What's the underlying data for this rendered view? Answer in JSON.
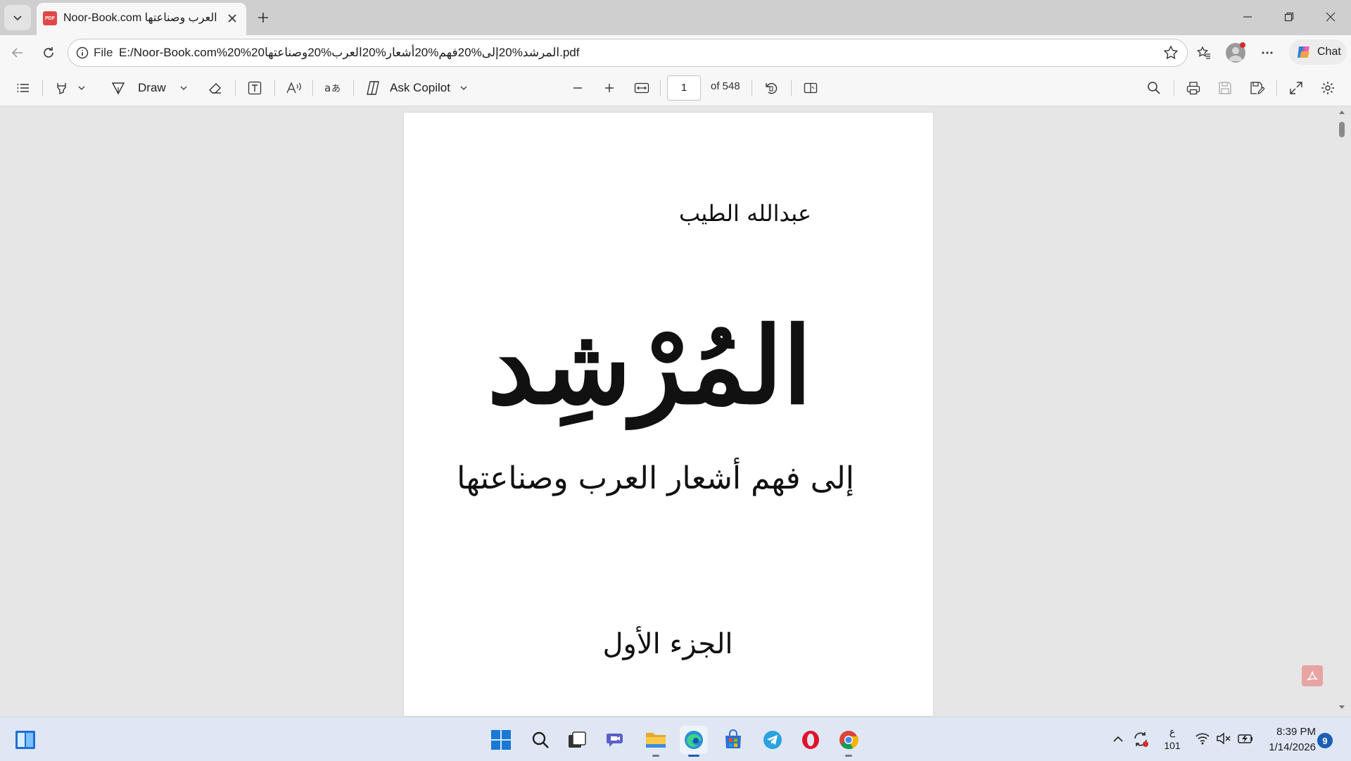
{
  "browser": {
    "tab": {
      "title": "Noor-Book.com عار العرب وصناعتها",
      "favicon_label": "PDF"
    },
    "address": {
      "scheme_label": "File",
      "url": "E:/Noor-Book.com%20%20المرشد%20إلى%20فهم%20أشعار%20العرب%20وصناعتها.pdf"
    },
    "chat_label": "Chat"
  },
  "pdf_toolbar": {
    "draw_label": "Draw",
    "ask_copilot_label": "Ask Copilot",
    "page_current": "1",
    "page_total_label": "of 548"
  },
  "document": {
    "author": "عبدالله الطيب",
    "title": "المُرْشِد",
    "subtitle": "إلى فهم أشعار العرب وصناعتها",
    "volume": "الجزء الأول"
  },
  "taskbar": {
    "language_top": "ع",
    "language_bottom": "101",
    "time": "8:39 PM",
    "date": "1/14/2026",
    "notification_count": "9"
  },
  "colors": {
    "accent": "#1a5fb4",
    "pdf_red": "#e04848"
  }
}
